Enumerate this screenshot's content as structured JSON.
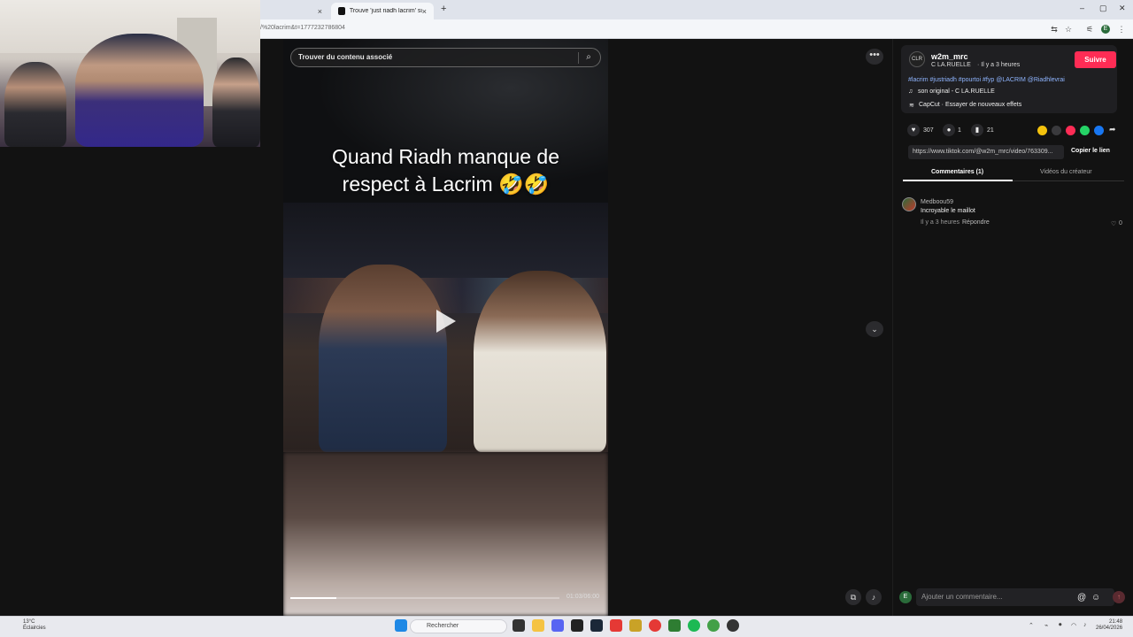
{
  "browser": {
    "tab_prev_close": "×",
    "tab_active_title": "Trouve 'just riadh lacrim' sur Ti",
    "tab_close": "×",
    "new_tab": "+",
    "url": "/%20lacrim&t=1777232786804",
    "window_min": "–",
    "window_max": "▢",
    "window_close": "✕"
  },
  "video": {
    "search_placeholder": "Trouver du contenu associé",
    "caption_line1": "Quand Riadh manque de",
    "caption_line2": "respect à Lacrim 🤣🤣",
    "time": "01:03/06:00",
    "progress": 0.17
  },
  "post": {
    "username": "w2m_mrc",
    "author_line": "C LA.RUELLE",
    "time_ago": " · Il y a 3 heures",
    "follow_label": "Suivre",
    "hashtags": "#lacrim #justriadh #pourtoi #fyp @LACRIM @Riadhlevrai",
    "sound": "son original - C LA.RUELLE",
    "capcut": "CapCut · Essayer de nouveaux effets",
    "likes": "307",
    "comments": "1",
    "saves": "21",
    "link": "https://www.tiktok.com/@w2m_mrc/video/763309...",
    "copy_label": "Copier le lien",
    "tab_comments": "Commentaires (1)",
    "tab_creator": "Vidéos du créateur"
  },
  "comment": {
    "author": "Medboou59",
    "text": "Incroyable le maillot",
    "time": "Il y a 3 heures",
    "reply_label": "Répondre",
    "likes": "0"
  },
  "composer": {
    "avatar_letter": "E",
    "placeholder": "Ajouter un commentaire..."
  },
  "taskbar": {
    "weather_temp": "13°C",
    "weather_desc": "Éclaircies",
    "search_label": "Rechercher",
    "time": "21:48",
    "date": "26/04/2026"
  },
  "colors": {
    "accent": "#fe2c55",
    "hashtag": "#8fb5ff",
    "panel_bg": "#121212"
  }
}
